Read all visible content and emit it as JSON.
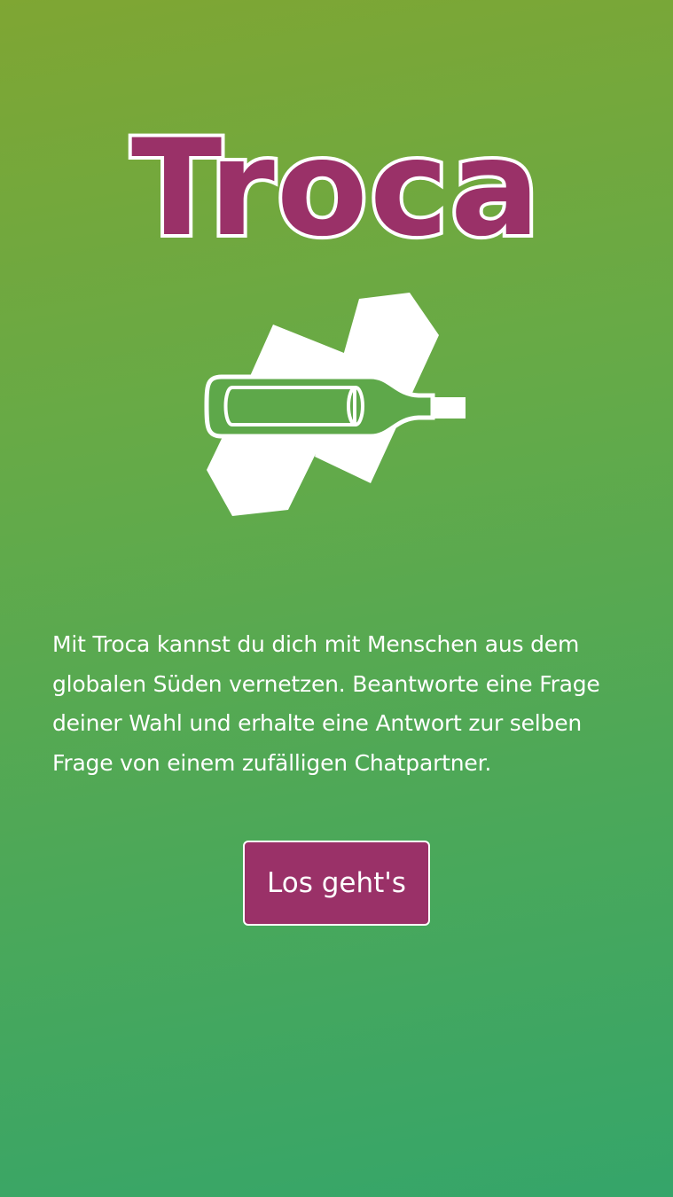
{
  "brand": {
    "name": "Troca",
    "primary_color": "#9a3168",
    "gradient_top": "#7fa633",
    "gradient_bottom": "#35a56a"
  },
  "logo": {
    "icon": "message-in-bottle-icon"
  },
  "intro": {
    "text": "Mit Troca kannst du dich mit Menschen aus dem globalen Süden vernetzen. Beantworte eine Frage deiner Wahl und erhalte eine Antwort zur selben Frage von einem zufälligen Chatpartner."
  },
  "cta": {
    "label": "Los geht's"
  }
}
